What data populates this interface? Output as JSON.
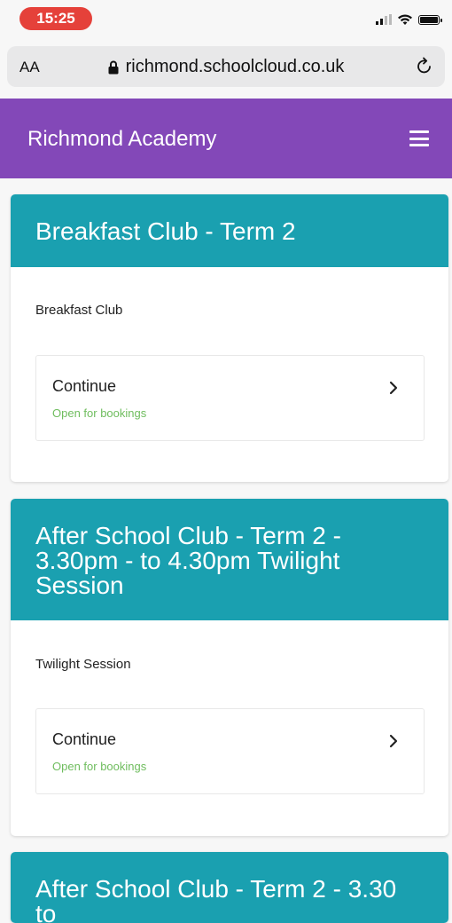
{
  "status_bar": {
    "time": "15:25"
  },
  "browser": {
    "text_size_label": "AA",
    "url": "richmond.schoolcloud.co.uk"
  },
  "header": {
    "title": "Richmond Academy"
  },
  "cards": [
    {
      "title": "Breakfast Club - Term 2",
      "description": "Breakfast Club",
      "action_label": "Continue",
      "status": "Open for bookings"
    },
    {
      "title": "After School Club - Term 2 - 3.30pm - to 4.30pm Twilight Session",
      "description": "Twilight Session",
      "action_label": "Continue",
      "status": "Open for bookings"
    },
    {
      "title": "After School Club - Term 2 - 3.30 to"
    }
  ],
  "colors": {
    "header_bg": "#8348b8",
    "card_header_bg": "#1aa0b0",
    "status_green": "#6fbd5e",
    "time_pill": "#e5413a"
  },
  "icons": {
    "lock": "lock-icon",
    "reload": "reload-icon",
    "menu": "hamburger-menu-icon",
    "chevron": "chevron-right-icon"
  }
}
